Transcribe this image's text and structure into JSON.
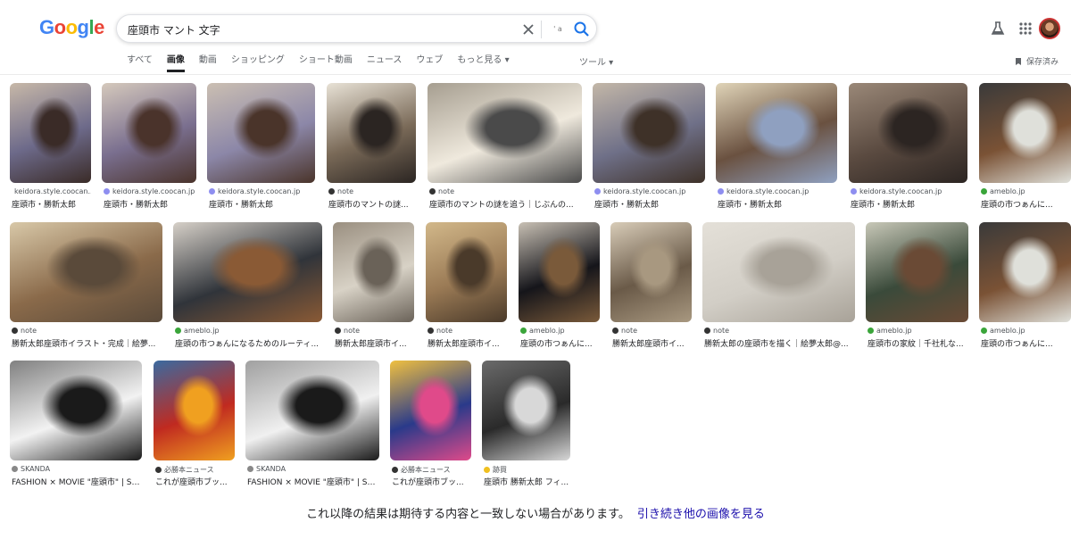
{
  "logo": {
    "letters": [
      "G",
      "o",
      "o",
      "g",
      "l",
      "e"
    ],
    "colors": [
      "#4285F4",
      "#EA4335",
      "#FBBC05",
      "#4285F4",
      "#34A853",
      "#EA4335"
    ]
  },
  "search": {
    "query": "座頭市 マント 文字",
    "lens_hint": "' a"
  },
  "tabs": [
    "すべて",
    "画像",
    "動画",
    "ショッピング",
    "ショート動画",
    "ニュース",
    "ウェブ",
    "もっと見る ▾"
  ],
  "active_tab": "画像",
  "tools_label": "ツール ▾",
  "saved_label": "保存済み",
  "results": [
    {
      "source": "keidora.style.coocan...",
      "title": "座頭市・勝新太郎",
      "fav": "#8e8ef0",
      "palette": [
        "#6d6a8a",
        "#3a2b27",
        "#c7b8a8"
      ]
    },
    {
      "source": "keidora.style.coocan.jp",
      "title": "座頭市・勝新太郎",
      "fav": "#8e8ef0",
      "palette": [
        "#7a6f8f",
        "#4a332b",
        "#d5c9bc"
      ]
    },
    {
      "source": "keidora.style.coocan.jp",
      "title": "座頭市・勝新太郎",
      "fav": "#8e8ef0",
      "palette": [
        "#8c87a8",
        "#4a342a",
        "#cbbfb2"
      ]
    },
    {
      "source": "note",
      "title": "座頭市のマントの謎...",
      "fav": "#333333",
      "palette": [
        "#7a6a58",
        "#2b2522",
        "#e8e2d6"
      ]
    },
    {
      "source": "note",
      "title": "座頭市のマントの謎を追う｜じぶんの...",
      "fav": "#333333",
      "palette": [
        "#efe9dd",
        "#4a4a4a",
        "#a69e90"
      ]
    },
    {
      "source": "keidora.style.coocan.jp",
      "title": "座頭市・勝新太郎",
      "fav": "#8e8ef0",
      "palette": [
        "#6f7088",
        "#3e3128",
        "#c3b7a8"
      ]
    },
    {
      "source": "keidora.style.coocan.jp",
      "title": "座頭市・勝新太郎",
      "fav": "#8e8ef0",
      "palette": [
        "#6a5140",
        "#8fa0c0",
        "#e0d4b8"
      ]
    },
    {
      "source": "keidora.style.coocan.jp",
      "title": "座頭市・勝新太郎",
      "fav": "#8e8ef0",
      "palette": [
        "#5a4a40",
        "#2c2522",
        "#9a8878"
      ]
    },
    {
      "source": "ameblo.jp",
      "title": "座頭の市つぁんに...",
      "fav": "#3aa53a",
      "palette": [
        "#7a5235",
        "#dfe0da",
        "#3a3a3a"
      ]
    },
    {
      "source": "note",
      "title": "勝新太郎座頭市イラスト・完成｜絵夢...",
      "fav": "#333333",
      "palette": [
        "#8a6a4a",
        "#5a4a3a",
        "#d8c8a8"
      ]
    },
    {
      "source": "ameblo.jp",
      "title": "座頭の市つぁんになるためのルーティ...",
      "fav": "#3aa53a",
      "palette": [
        "#30343a",
        "#8a5a35",
        "#d6d0c8"
      ]
    },
    {
      "source": "note",
      "title": "勝新太郎座頭市イ...",
      "fav": "#333333",
      "palette": [
        "#d8d2c6",
        "#6a6258",
        "#9a8f80"
      ]
    },
    {
      "source": "note",
      "title": "勝新太郎座頭市イ...",
      "fav": "#333333",
      "palette": [
        "#9a7a55",
        "#4a3a2a",
        "#d2b88a"
      ]
    },
    {
      "source": "ameblo.jp",
      "title": "座頭の市つぁんに...",
      "fav": "#3aa53a",
      "palette": [
        "#15151a",
        "#7a5a3a",
        "#c8c0b4"
      ]
    },
    {
      "source": "note",
      "title": "勝新太郎座頭市イ...",
      "fav": "#333333",
      "palette": [
        "#6a5a48",
        "#a89880",
        "#d8ccb8"
      ]
    },
    {
      "source": "note",
      "title": "勝新太郎の座頭市を描く｜絵夢太郎@...",
      "fav": "#333333",
      "palette": [
        "#d2cec6",
        "#a8a298",
        "#e4e0d8"
      ]
    },
    {
      "source": "ameblo.jp",
      "title": "座頭市の家紋｜千社札な...",
      "fav": "#3aa53a",
      "palette": [
        "#3a4a3a",
        "#6a4a35",
        "#c8c8b8"
      ]
    },
    {
      "source": "ameblo.jp",
      "title": "座頭の市つぁんに...",
      "fav": "#3aa53a",
      "palette": [
        "#7a5235",
        "#dfe0da",
        "#3a3a3a"
      ]
    },
    {
      "source": "SKANDA",
      "title": "FASHION × MOVIE \"座頭市\" | SK...",
      "fav": "#888888",
      "palette": [
        "#f2f2f2",
        "#1a1a1a",
        "#808080"
      ]
    },
    {
      "source": "必勝本ニュース",
      "title": "これが座頭市ブッ...",
      "fav": "#333333",
      "palette": [
        "#c02a20",
        "#f0a020",
        "#3a6aa0"
      ]
    },
    {
      "source": "SKANDA",
      "title": "FASHION × MOVIE \"座頭市\" | SK...",
      "fav": "#888888",
      "palette": [
        "#f0f0f0",
        "#1a1a1a",
        "#a0a0a0"
      ]
    },
    {
      "source": "必勝本ニュース",
      "title": "これが座頭市ブッ...",
      "fav": "#333333",
      "palette": [
        "#2a3a8a",
        "#e04a8a",
        "#f0c040"
      ]
    },
    {
      "source": "跡買",
      "title": "座頭市 勝新太郎 フィ...",
      "fav": "#f0c020",
      "palette": [
        "#2a2a2a",
        "#d8d8d8",
        "#6a6a6a"
      ]
    }
  ],
  "footer": {
    "message": "これ以降の結果は期待する内容と一致しない場合があります。",
    "link": "引き続き他の画像を見る"
  }
}
